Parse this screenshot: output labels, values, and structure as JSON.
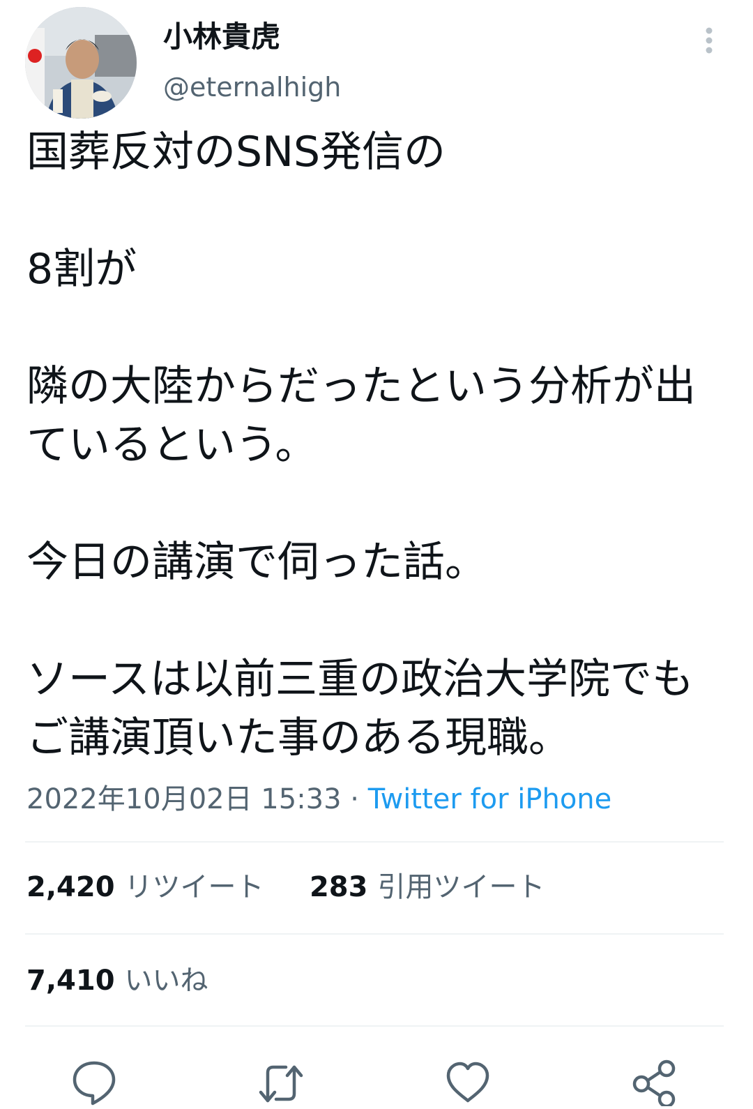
{
  "author": {
    "display_name": "小林貴虎",
    "handle": "@eternalhigh"
  },
  "tweet": {
    "text": "国葬反対のSNS発信の\n\n8割が\n\n隣の大陸からだったという分析が出ているという。\n\n今日の講演で伺った話。\n\nソースは以前三重の政治大学院でもご講演頂いた事のある現職。"
  },
  "meta": {
    "timestamp": "2022年10月02日 15:33",
    "separator": " · ",
    "source": "Twitter for iPhone"
  },
  "stats": {
    "retweets_count": "2,420",
    "retweets_label": "リツイート",
    "quotes_count": "283",
    "quotes_label": "引用ツイート",
    "likes_count": "7,410",
    "likes_label": "いいね"
  },
  "icons": {
    "more": "more-vertical-icon",
    "reply": "reply-icon",
    "retweet": "retweet-icon",
    "like": "heart-icon",
    "share": "share-icon"
  },
  "colors": {
    "text": "#0f1419",
    "secondary": "#536471",
    "link": "#1d9bf0",
    "divider": "#eff3f4"
  }
}
